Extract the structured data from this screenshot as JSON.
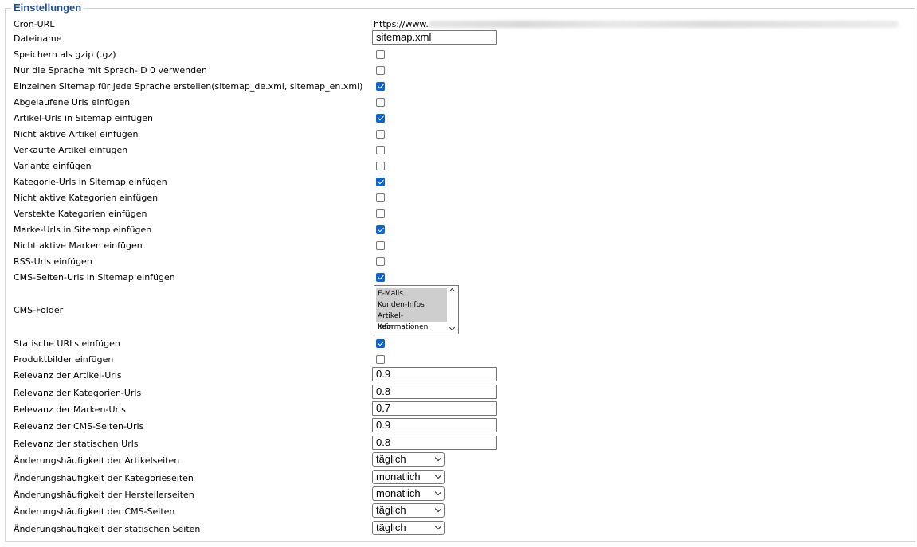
{
  "legend": "Einstellungen",
  "cron": {
    "label": "Cron-URL",
    "url_prefix": "https://www."
  },
  "filename": {
    "label": "Dateiname",
    "value": "sitemap.xml"
  },
  "checkboxes": [
    {
      "label": "Speichern als gzip (.gz)",
      "checked": false
    },
    {
      "label": "Nur die Sprache mit Sprach-ID 0 verwenden",
      "checked": false
    },
    {
      "label": "Einzelnen Sitemap für jede Sprache erstellen(sitemap_de.xml, sitemap_en.xml)",
      "checked": true
    },
    {
      "label": "Abgelaufene Urls einfügen",
      "checked": false
    },
    {
      "label": "Artikel-Urls in Sitemap einfügen",
      "checked": true
    },
    {
      "label": "Nicht aktive Artikel einfügen",
      "checked": false
    },
    {
      "label": "Verkaufte Artikel einfügen",
      "checked": false
    },
    {
      "label": "Variante einfügen",
      "checked": false
    },
    {
      "label": "Kategorie-Urls in Sitemap einfügen",
      "checked": true
    },
    {
      "label": "Nicht aktive Kategorien einfügen",
      "checked": false
    },
    {
      "label": "Verstekte Kategorien einfügen",
      "checked": false
    },
    {
      "label": "Marke-Urls in Sitemap einfügen",
      "checked": true
    },
    {
      "label": "Nicht aktive Marken einfügen",
      "checked": false
    },
    {
      "label": "RSS-Urls einfügen",
      "checked": false
    },
    {
      "label": "CMS-Seiten-Urls in Sitemap einfügen",
      "checked": true
    }
  ],
  "cms_folder": {
    "label": "CMS-Folder",
    "options": [
      {
        "text": "E-Mails",
        "selected": true
      },
      {
        "text": "Kunden-Infos",
        "selected": true
      },
      {
        "text": "Artikel-Informationen",
        "selected": true
      },
      {
        "text": "Kein",
        "selected": false
      }
    ]
  },
  "checkboxes2": [
    {
      "label": "Statische URLs einfügen",
      "checked": true
    },
    {
      "label": "Produktbilder einfügen",
      "checked": false
    }
  ],
  "relevance": [
    {
      "label": "Relevanz der Artikel-Urls",
      "value": "0.9"
    },
    {
      "label": "Relevanz der Kategorien-Urls",
      "value": "0.8"
    },
    {
      "label": "Relevanz der Marken-Urls",
      "value": "0.7"
    },
    {
      "label": "Relevanz der CMS-Seiten-Urls",
      "value": "0.9"
    },
    {
      "label": "Relevanz der statischen Urls",
      "value": "0.8"
    }
  ],
  "frequency": [
    {
      "label": "Änderungshäufigkeit der Artikelseiten",
      "value": "täglich"
    },
    {
      "label": "Änderungshäufigkeit der Kategorieseiten",
      "value": "monatlich"
    },
    {
      "label": "Änderungshäufigkeit der Herstellerseiten",
      "value": "monatlich"
    },
    {
      "label": "Änderungshäufigkeit der CMS-Seiten",
      "value": "täglich"
    },
    {
      "label": "Änderungshäufigkeit der statischen Seiten",
      "value": "täglich"
    }
  ]
}
